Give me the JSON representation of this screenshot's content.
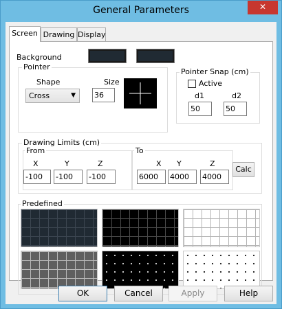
{
  "window": {
    "title": "General Parameters",
    "close_glyph": "✕"
  },
  "tabs": [
    {
      "label": "Screen",
      "active": true
    },
    {
      "label": "Drawing",
      "active": false
    },
    {
      "label": "Display",
      "active": false
    }
  ],
  "background": {
    "label": "Background",
    "color1": "#202a33",
    "color2": "#202a33"
  },
  "pointer": {
    "group_label": "Pointer",
    "shape_label": "Shape",
    "shape_value": "Cross",
    "size_label": "Size",
    "size_value": "36"
  },
  "snap": {
    "group_label": "Pointer Snap (cm)",
    "active_label": "Active",
    "active_checked": false,
    "d1_label": "d1",
    "d1_value": "50",
    "d2_label": "d2",
    "d2_value": "50"
  },
  "limits": {
    "group_label": "Drawing Limits (cm)",
    "from_label": "From",
    "to_label": "To",
    "x_label": "X",
    "y_label": "Y",
    "z_label": "Z",
    "from_x": "-100",
    "from_y": "-100",
    "from_z": "-100",
    "to_x": "6000",
    "to_y": "4000",
    "to_z": "4000",
    "calc_label": "Calc"
  },
  "predefined": {
    "group_label": "Predefined",
    "presets": [
      {
        "bg": "#202a33",
        "grid": "#3c4651",
        "style": "lines"
      },
      {
        "bg": "#000000",
        "grid": "#4a4a4a",
        "style": "lines"
      },
      {
        "bg": "#ffffff",
        "grid": "#b4b4b4",
        "style": "lines"
      },
      {
        "bg": "#5f5f5f",
        "grid": "#b9b9b9",
        "style": "lines"
      },
      {
        "bg": "#000000",
        "grid": "#d0d0d0",
        "style": "dots"
      },
      {
        "bg": "#ffffff",
        "grid": "#222222",
        "style": "dots"
      }
    ]
  },
  "buttons": {
    "ok": "OK",
    "cancel": "Cancel",
    "apply": "Apply",
    "help": "Help"
  }
}
